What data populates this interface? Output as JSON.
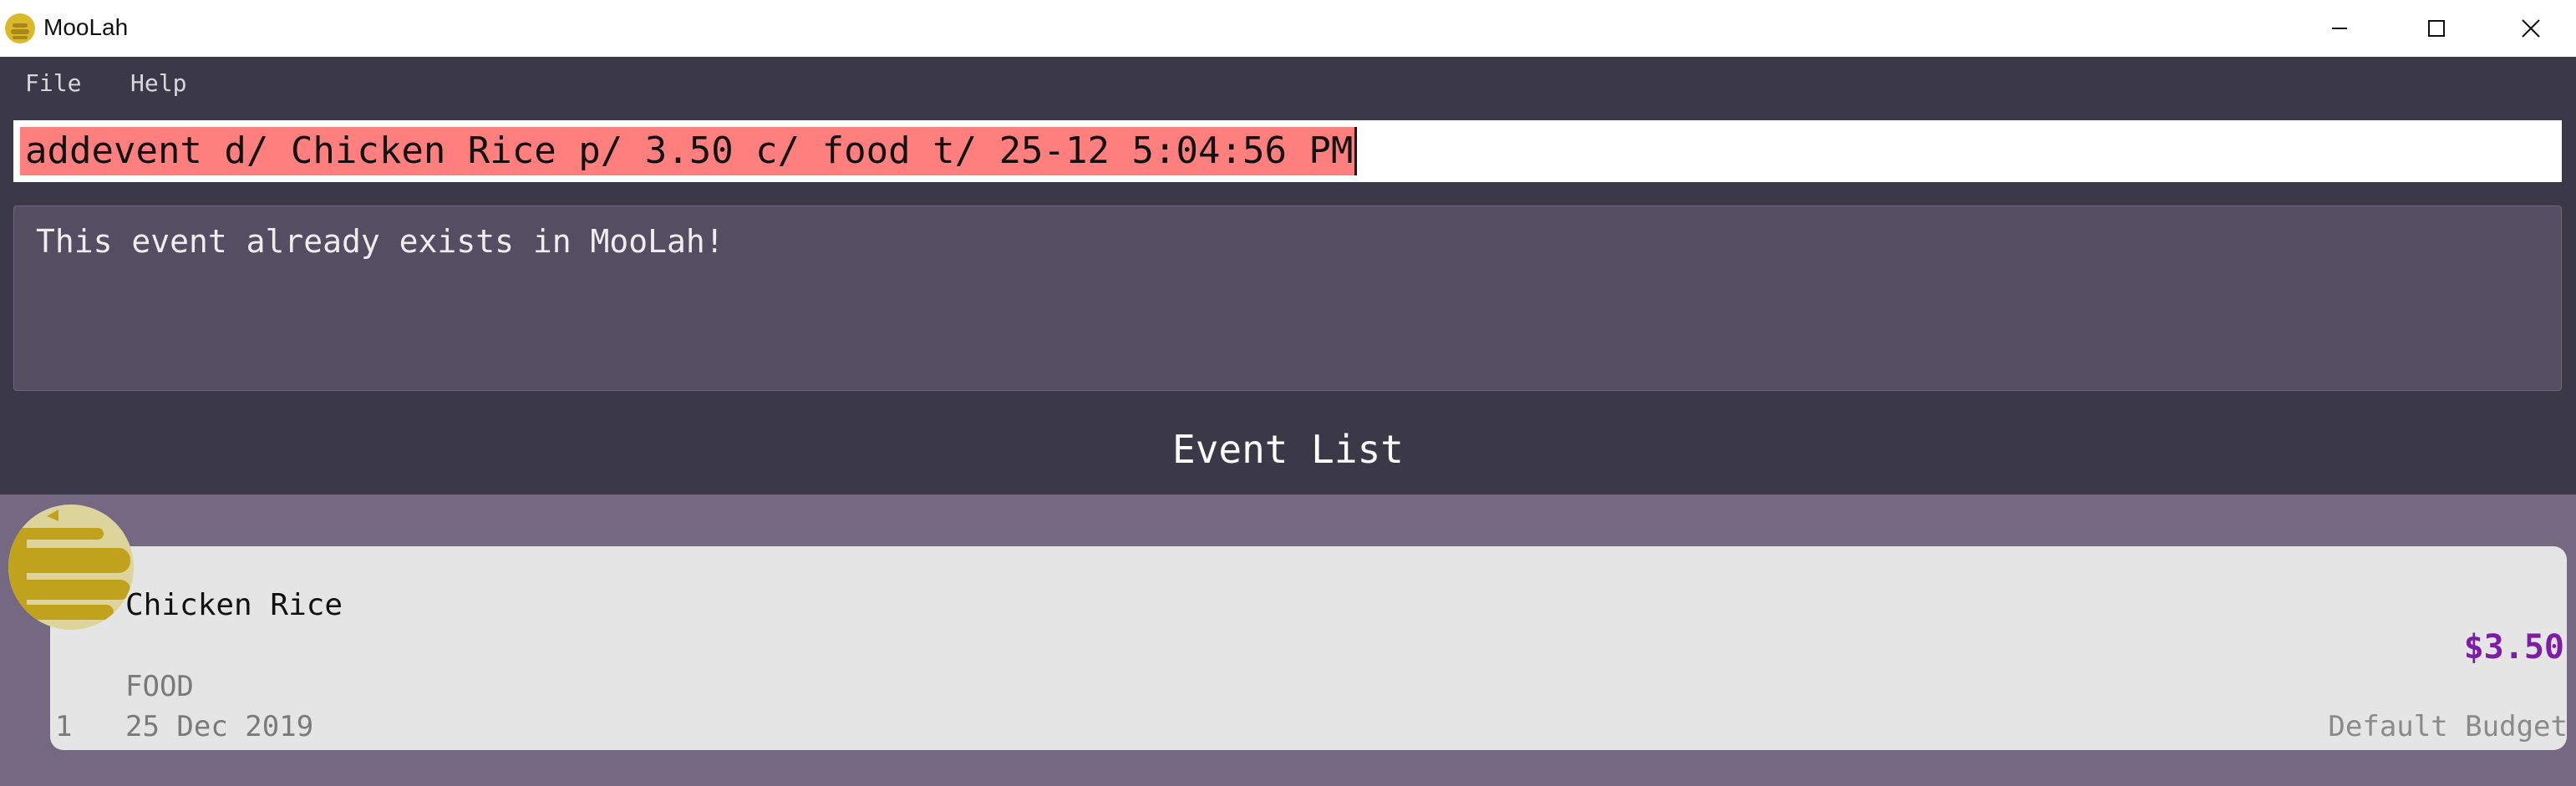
{
  "window": {
    "title": "MooLah"
  },
  "menu": {
    "items": [
      "File",
      "Help"
    ]
  },
  "command": {
    "text": "addevent d/ Chicken Rice p/ 3.50 c/ food t/ 25-12 5:04:56 PM"
  },
  "result": {
    "text": "This event already exists in MooLah!"
  },
  "event_list": {
    "title": "Event List",
    "events": [
      {
        "index": "1",
        "description": "Chicken Rice",
        "price": "$3.50",
        "category": "FOOD",
        "date": "25 Dec 2019",
        "budget": "Default Budget",
        "icon": "food-icon"
      }
    ]
  },
  "colors": {
    "background": "#3b3848",
    "command_error": "#ff7f7f",
    "result_box": "#544e62",
    "list_background": "#756882",
    "card": "#e5e5e5",
    "price": "#7d1ca6",
    "icon_gold": "#d8b92a"
  }
}
